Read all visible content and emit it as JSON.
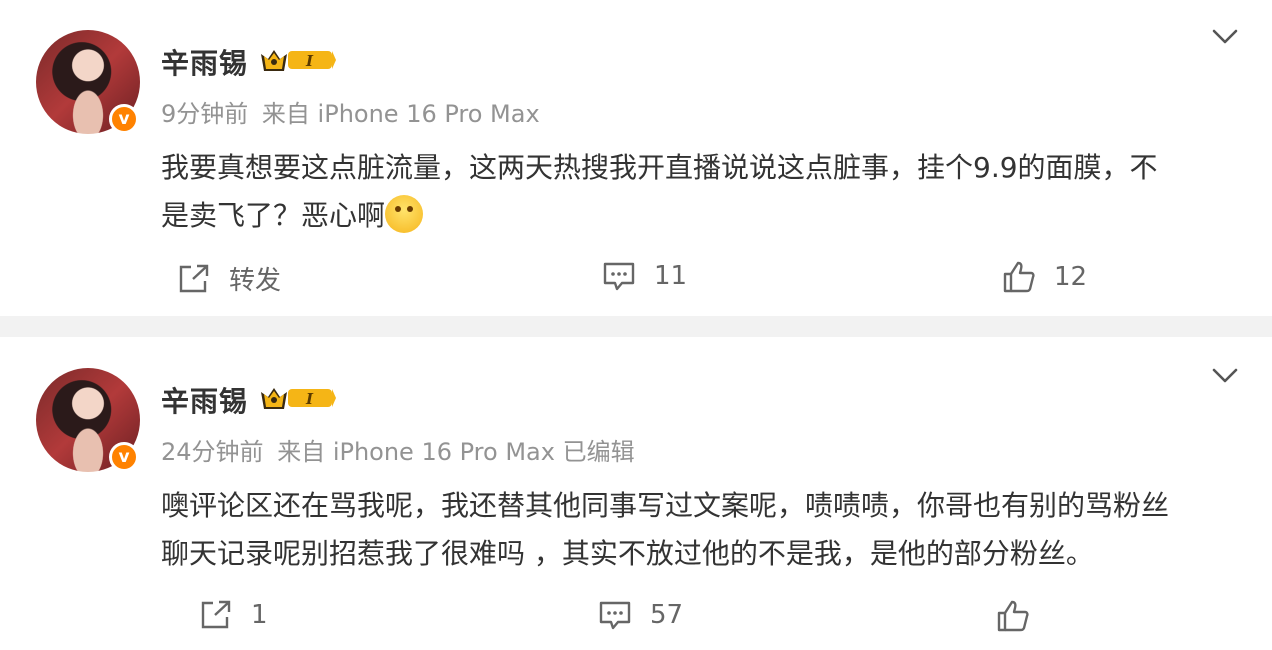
{
  "posts": [
    {
      "author": "辛雨锡",
      "level": "I",
      "time": "9分钟前",
      "source": "来自 iPhone 16 Pro Max",
      "content_line1": "我要真想要这点脏流量，这两天热搜我开直播说说这点脏事，挂个9.9的面膜，不",
      "content_line2": "是卖飞了？恶心啊",
      "repost_label": "转发",
      "comments": "11",
      "likes": "12"
    },
    {
      "author": "辛雨锡",
      "level": "I",
      "time": "24分钟前",
      "source": "来自 iPhone 16 Pro Max 已编辑",
      "content_line1": "噢评论区还在骂我呢，我还替其他同事写过文案呢，啧啧啧，你哥也有别的骂粉丝",
      "content_line2": "聊天记录呢别招惹我了很难吗 ，其实不放过他的不是我，是他的部分粉丝。",
      "repost_label": "1",
      "comments": "57",
      "likes": ""
    }
  ],
  "verified_badge": "v",
  "colors": {
    "verified": "#ff8200",
    "crown": "#f5b516",
    "meta_text": "#939393"
  },
  "icons": [
    "avatar",
    "verified-badge-icon",
    "crown-level-icon",
    "chevron-down-icon",
    "repost-icon",
    "comment-icon",
    "like-icon"
  ]
}
